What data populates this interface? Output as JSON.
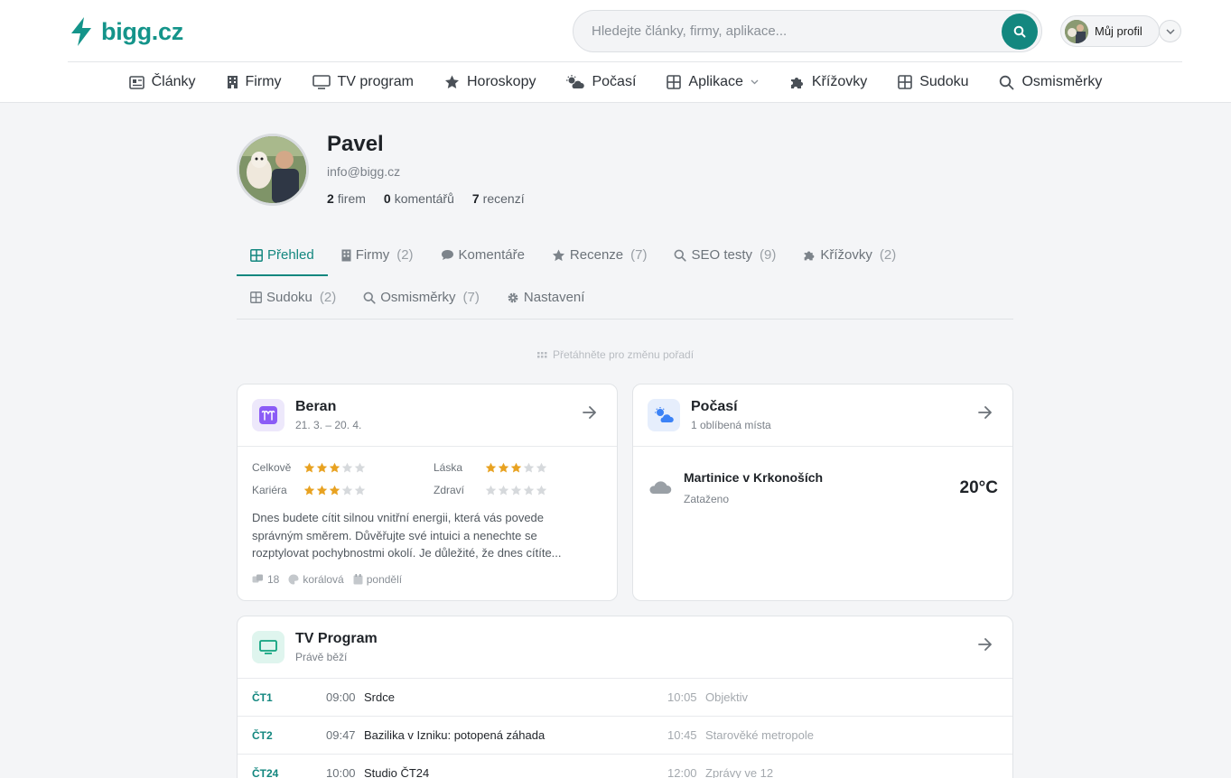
{
  "header": {
    "logo": "bigg.cz",
    "search_placeholder": "Hledejte články, firmy, aplikace...",
    "profile_label": "Můj profil"
  },
  "nav": [
    {
      "label": "Články",
      "icon": "newspaper-icon"
    },
    {
      "label": "Firmy",
      "icon": "building-icon"
    },
    {
      "label": "TV program",
      "icon": "tv-icon"
    },
    {
      "label": "Horoskopy",
      "icon": "star-icon"
    },
    {
      "label": "Počasí",
      "icon": "cloud-sun-icon"
    },
    {
      "label": "Aplikace",
      "icon": "grid-icon"
    },
    {
      "label": "Křížovky",
      "icon": "puzzle-icon"
    },
    {
      "label": "Sudoku",
      "icon": "grid-icon"
    },
    {
      "label": "Osmisměrky",
      "icon": "search-icon"
    }
  ],
  "user": {
    "name": "Pavel",
    "email": "info@bigg.cz",
    "stats": {
      "firms_count": "2",
      "firms_label": "firem",
      "comments_count": "0",
      "comments_label": "komentářů",
      "reviews_count": "7",
      "reviews_label": "recenzí"
    }
  },
  "tabs": {
    "overview": {
      "label": "Přehled",
      "count": ""
    },
    "firms": {
      "label": "Firmy",
      "count": "(2)"
    },
    "comments": {
      "label": "Komentáře",
      "count": ""
    },
    "reviews": {
      "label": "Recenze",
      "count": "(7)"
    },
    "seo": {
      "label": "SEO testy",
      "count": "(9)"
    },
    "crosswords": {
      "label": "Křížovky",
      "count": "(2)"
    },
    "sudoku": {
      "label": "Sudoku",
      "count": "(2)"
    },
    "wordsearch": {
      "label": "Osmisměrky",
      "count": "(7)"
    },
    "settings": {
      "label": "Nastavení",
      "count": ""
    }
  },
  "drag_hint": "Přetáhněte pro změnu pořadí",
  "horoscope": {
    "title": "Beran",
    "dates": "21. 3. – 20. 4.",
    "ratings": {
      "overall": {
        "label": "Celkově",
        "stars": 3
      },
      "love": {
        "label": "Láska",
        "stars": 3
      },
      "career": {
        "label": "Kariéra",
        "stars": 3
      },
      "health": {
        "label": "Zdraví",
        "stars": 0
      }
    },
    "text": "Dnes budete cítit silnou vnitřní energii, která vás povede správným směrem. Důvěřujte své intuici a nenechte se rozptylovat pochybnostmi okolí. Je důležité, že dnes cítíte...",
    "lucky_number": "18",
    "color": "korálová",
    "day": "pondělí"
  },
  "weather": {
    "title": "Počasí",
    "subtitle": "1 oblíbená místa",
    "city": "Martinice v Krkonoších",
    "condition": "Zataženo",
    "temperature": "20°C"
  },
  "tv": {
    "title": "TV Program",
    "subtitle": "Právě běží",
    "rows": [
      {
        "channel": "ČT1",
        "time": "09:00",
        "title": "Srdce",
        "next_time": "10:05",
        "next_title": "Objektiv"
      },
      {
        "channel": "ČT2",
        "time": "09:47",
        "title": "Bazilika v Izniku: potopená záhada",
        "next_time": "10:45",
        "next_title": "Starověké metropole"
      },
      {
        "channel": "ČT24",
        "time": "10:00",
        "title": "Studio ČT24",
        "next_time": "12:00",
        "next_title": "Zprávy ve 12"
      }
    ]
  },
  "colors": {
    "accent": "#13877f",
    "star": "#e8a221",
    "star_empty": "#d6d9dc"
  }
}
